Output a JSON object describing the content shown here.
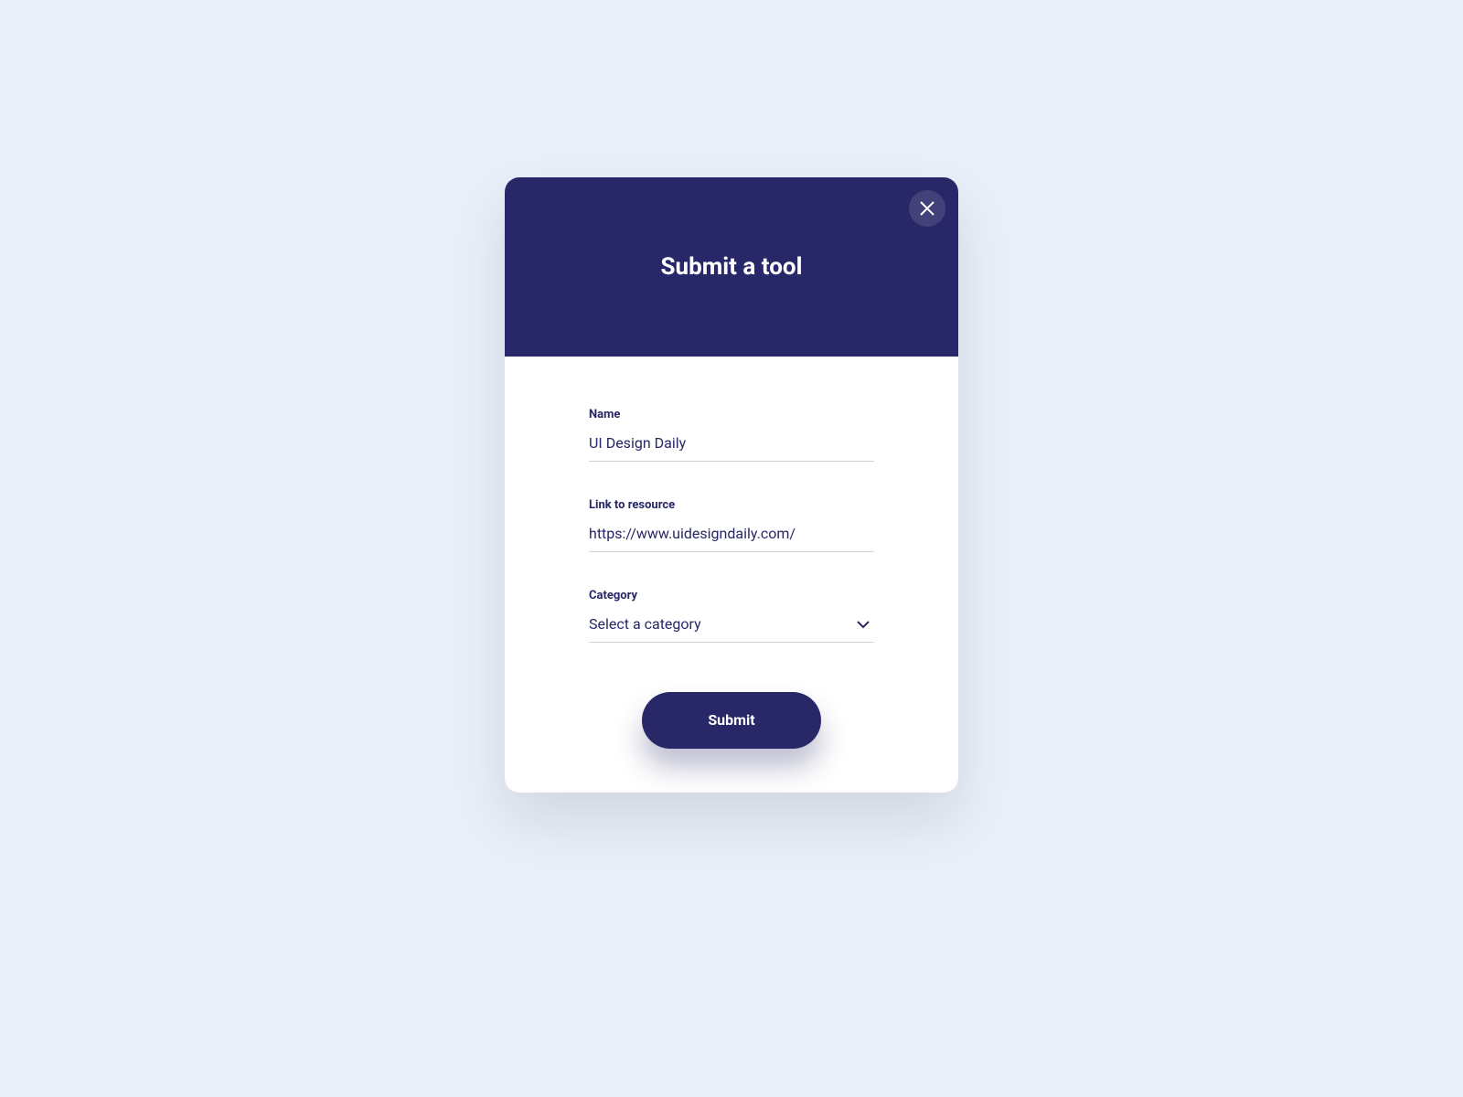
{
  "modal": {
    "title": "Submit a tool",
    "fields": {
      "name": {
        "label": "Name",
        "value": "UI Design Daily"
      },
      "link": {
        "label": "Link to resource",
        "value": "https://www.uidesigndaily.com/"
      },
      "category": {
        "label": "Category",
        "placeholder": "Select a category"
      }
    },
    "submit_label": "Submit"
  }
}
